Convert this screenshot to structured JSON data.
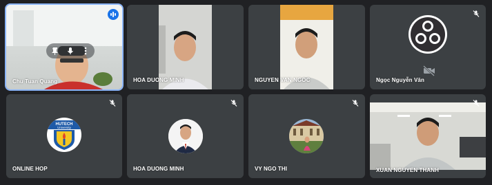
{
  "participants": [
    {
      "name": "Chu Tuan Quang",
      "muted": false,
      "speaking": true
    },
    {
      "name": "HOA DUONG MINH",
      "muted": false
    },
    {
      "name": "NGUYEN VAN NGOC",
      "muted": false
    },
    {
      "name": "Ngọc Nguyễn Văn",
      "muted": true,
      "camera_off": true
    },
    {
      "name": "ONLINE HOP",
      "muted": true
    },
    {
      "name": "HOA DUONG MINH",
      "muted": true
    },
    {
      "name": "VY NGO THI",
      "muted": true
    },
    {
      "name": "XUAN NGUYEN THANH",
      "muted": true
    }
  ],
  "logo": {
    "line1": "HUTECH",
    "line2": "University"
  },
  "icons": {
    "pin": "pin-icon",
    "mic_hover": "microphone-icon",
    "more": "more-vert-icon",
    "speaking": "audio-level-icon",
    "mic_off": "mic-off-icon",
    "camera_off": "camera-off-icon",
    "obs": "obs-logo-icon"
  },
  "colors": {
    "background": "#202124",
    "tile": "#3c4043",
    "active_outline": "#8ab4f8",
    "speaking": "#1a73e8",
    "brand_blue": "#1e5aa8",
    "brand_yellow": "#f3c623"
  }
}
